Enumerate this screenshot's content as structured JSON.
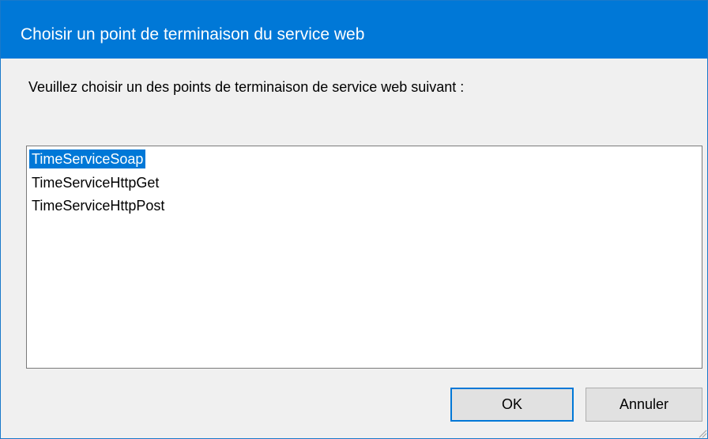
{
  "window": {
    "title": "Choisir un point de terminaison du service web"
  },
  "prompt": "Veuillez choisir un des points de terminaison de service web suivant :",
  "endpoints": {
    "items": [
      "TimeServiceSoap",
      "TimeServiceHttpGet",
      "TimeServiceHttpPost"
    ],
    "selected": "TimeServiceSoap"
  },
  "buttons": {
    "ok": "OK",
    "cancel": "Annuler"
  },
  "colors": {
    "accent": "#0078d7",
    "dialog_bg": "#f0f0f0",
    "button_bg": "#e1e1e1"
  },
  "icons": {
    "resize_grip": "resize-grip-icon"
  }
}
